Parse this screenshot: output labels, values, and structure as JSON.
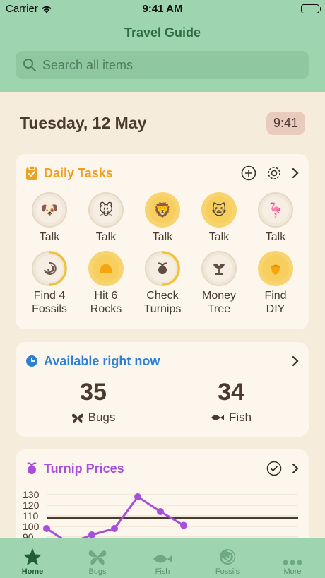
{
  "status": {
    "carrier": "Carrier",
    "time": "9:41 AM"
  },
  "header": {
    "title": "Travel Guide"
  },
  "search": {
    "placeholder": "Search all items"
  },
  "date": {
    "label": "Tuesday, 12 May",
    "clock": "9:41"
  },
  "tasks": {
    "title": "Daily Tasks",
    "accent": "#f0a020",
    "items": [
      {
        "label": "Talk",
        "icon": "dog-villager-icon",
        "done": false
      },
      {
        "label": "Talk",
        "icon": "mouse-villager-icon",
        "done": false
      },
      {
        "label": "Talk",
        "icon": "lion-villager-icon",
        "done": true
      },
      {
        "label": "Talk",
        "icon": "cat-villager-icon",
        "done": true
      },
      {
        "label": "Talk",
        "icon": "flamingo-villager-icon",
        "done": false
      },
      {
        "label": "Find 4\nFossils",
        "icon": "fossil-icon",
        "progress": 0.5
      },
      {
        "label": "Hit 6\nRocks",
        "icon": "rock-icon",
        "done": true
      },
      {
        "label": "Check\nTurnips",
        "icon": "turnip-icon",
        "progress": 0.5
      },
      {
        "label": "Money\nTree",
        "icon": "sprout-icon",
        "done": false
      },
      {
        "label": "Find\nDIY",
        "icon": "acorn-icon",
        "done": true
      }
    ]
  },
  "available": {
    "title": "Available right now",
    "accent": "#2d7fd4",
    "bugs_count": "35",
    "bugs_label": "Bugs",
    "fish_count": "34",
    "fish_label": "Fish"
  },
  "turnips": {
    "title": "Turnip Prices",
    "accent": "#a64fdb"
  },
  "chart_data": {
    "type": "line",
    "y_ticks": [
      "130",
      "120",
      "110",
      "100",
      "90"
    ],
    "ylim": [
      80,
      135
    ],
    "buy_price": 108,
    "series": [
      {
        "values": [
          98,
          84,
          92,
          98,
          128,
          114,
          101
        ]
      }
    ]
  },
  "tabs": [
    {
      "label": "Home",
      "icon": "star-icon",
      "active": true
    },
    {
      "label": "Bugs",
      "icon": "butterfly-icon",
      "active": false
    },
    {
      "label": "Fish",
      "icon": "fish-icon",
      "active": false
    },
    {
      "label": "Fossils",
      "icon": "shell-icon",
      "active": false
    },
    {
      "label": "More",
      "icon": "more-icon",
      "active": false
    }
  ]
}
